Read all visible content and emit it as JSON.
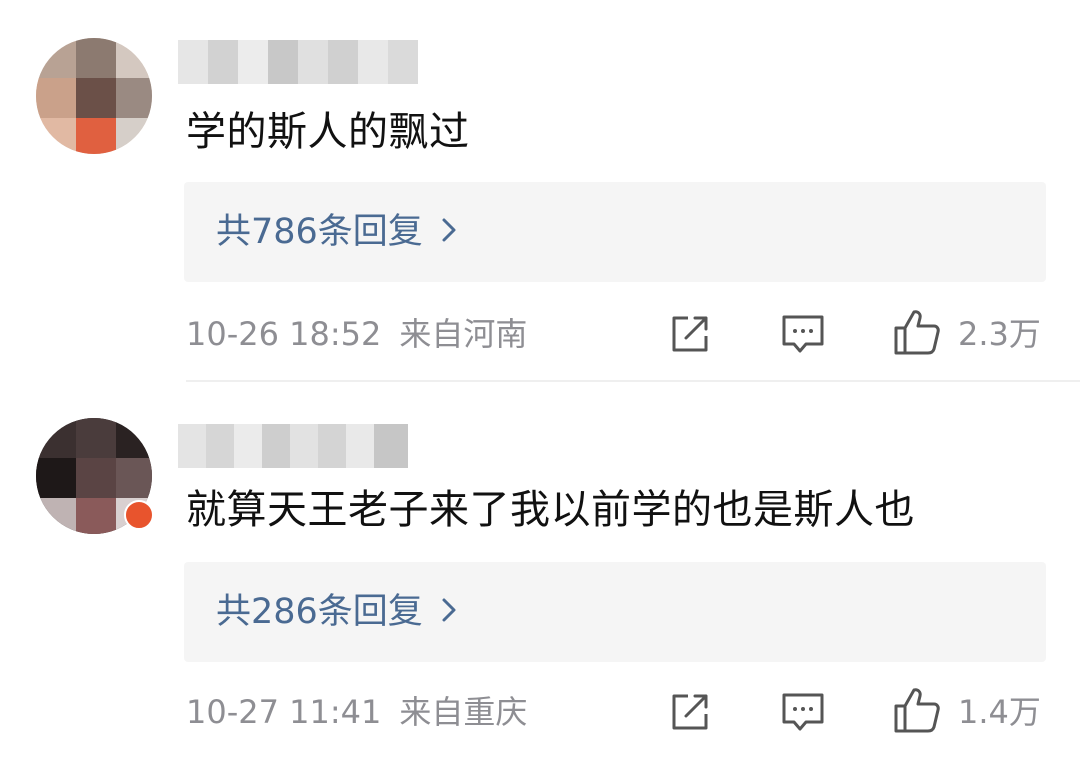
{
  "comments": [
    {
      "text": "学的斯人的飘过",
      "reply_link": "共786条回复",
      "time": "10-26 18:52",
      "location": "来自河南",
      "likes": "2.3万",
      "avatar_color": "#c9a58f",
      "accent": "#4a6a92"
    },
    {
      "text": "就算天王老子来了我以前学的也是斯人也",
      "reply_link": "共286条回复",
      "time": "10-27 11:41",
      "location": "来自重庆",
      "likes": "1.4万",
      "avatar_color": "#3a2c2c",
      "badge_color": "#e8542d"
    }
  ],
  "icons": {
    "share": "share-icon",
    "comment": "comment-icon",
    "like": "thumbs-up-icon",
    "chevron": "chevron-right-icon"
  }
}
